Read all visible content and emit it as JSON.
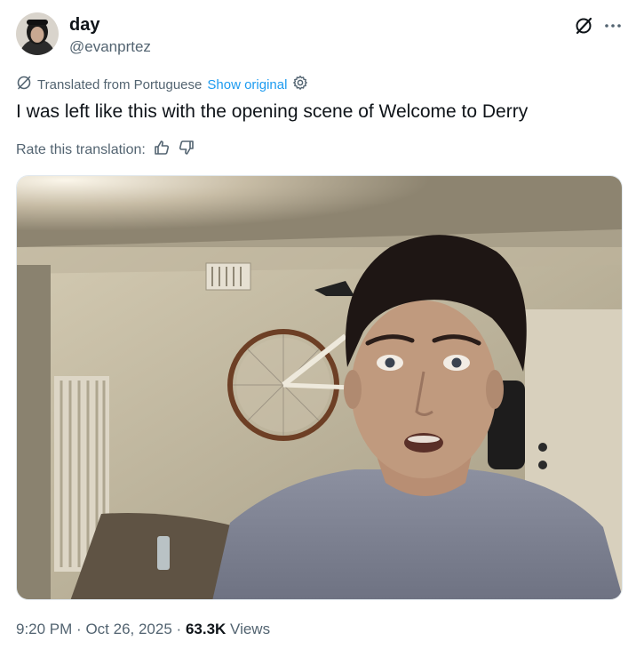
{
  "author": {
    "display_name": "day",
    "handle": "@evanprtez"
  },
  "actions": {
    "grok_icon": "grok-icon",
    "more_icon": "more-icon"
  },
  "translation": {
    "label": "Translated from Portuguese",
    "show_original": "Show original",
    "rate_label": "Rate this translation:"
  },
  "tweet": {
    "text": "I was left like this with the opening scene of Welcome to Derry"
  },
  "meta": {
    "time": "9:20 PM",
    "separator1": "·",
    "date": "Oct 26, 2025",
    "separator2": "·",
    "views_count": "63.3K",
    "views_label": "Views"
  },
  "colors": {
    "link": "#1d9bf0",
    "secondary_text": "#536471",
    "primary_text": "#0f1419"
  }
}
